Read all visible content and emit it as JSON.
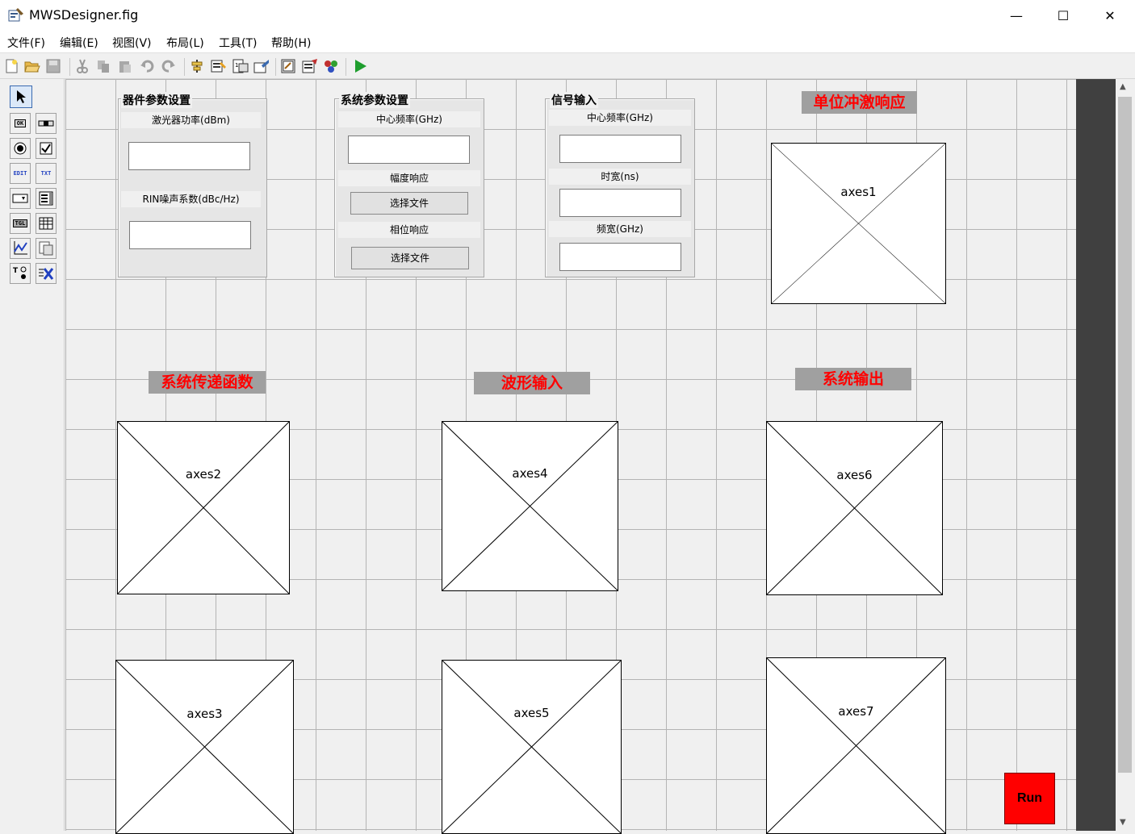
{
  "window": {
    "title": "MWSDesigner.fig",
    "minimize": "—",
    "maximize": "☐",
    "close": "✕"
  },
  "menu": [
    "文件(F)",
    "编辑(E)",
    "视图(V)",
    "布局(L)",
    "工具(T)",
    "帮助(H)"
  ],
  "toolbar_icons": [
    "new-icon",
    "open-icon",
    "save-icon",
    "cut-icon",
    "copy-icon",
    "paste-icon",
    "undo-icon",
    "redo-icon",
    "align-icon",
    "menu-editor-icon",
    "tab-order-icon",
    "toolbar-editor-icon",
    "editor-icon",
    "property-inspector-icon",
    "object-browser-icon",
    "run-icon"
  ],
  "palette": [
    "select-tool",
    "pushbutton-tool",
    "slider-tool",
    "radiobutton-tool",
    "checkbox-tool",
    "edit-text-tool",
    "static-text-tool",
    "popup-menu-tool",
    "listbox-tool",
    "toggle-button-tool",
    "table-tool",
    "axes-tool",
    "panel-tool",
    "button-group-tool",
    "activex-tool"
  ],
  "palette_labels": {
    "pushbutton": "OK",
    "edit": "EDIT",
    "text": "TXT",
    "toggle": "TGL"
  },
  "device_panel": {
    "title": "器件参数设置",
    "laser_power_label": "激光器功率(dBm)",
    "laser_power_value": "",
    "rin_label": "RIN噪声系数(dBc/Hz)",
    "rin_value": ""
  },
  "system_panel": {
    "title": "系统参数设置",
    "center_freq_label": "中心频率(GHz)",
    "center_freq_value": "",
    "amp_label": "幅度响应",
    "amp_button": "选择文件",
    "phase_label": "相位响应",
    "phase_button": "选择文件"
  },
  "signal_panel": {
    "title": "信号输入",
    "center_freq_label": "中心频率(GHz)",
    "center_freq_value": "",
    "time_label": "时宽(ns)",
    "time_value": "",
    "bw_label": "频宽(GHz)",
    "bw_value": ""
  },
  "headings": {
    "impulse": "单位冲激响应",
    "transfer": "系统传递函数",
    "waveform": "波形输入",
    "output": "系统输出"
  },
  "axes": {
    "a1": "axes1",
    "a2": "axes2",
    "a3": "axes3",
    "a4": "axes4",
    "a5": "axes5",
    "a6": "axes6",
    "a7": "axes7"
  },
  "run_button": "Run",
  "colors": {
    "heading_text": "#ff0000",
    "heading_bg": "#a0a0a0",
    "run_bg": "#ff0000"
  }
}
